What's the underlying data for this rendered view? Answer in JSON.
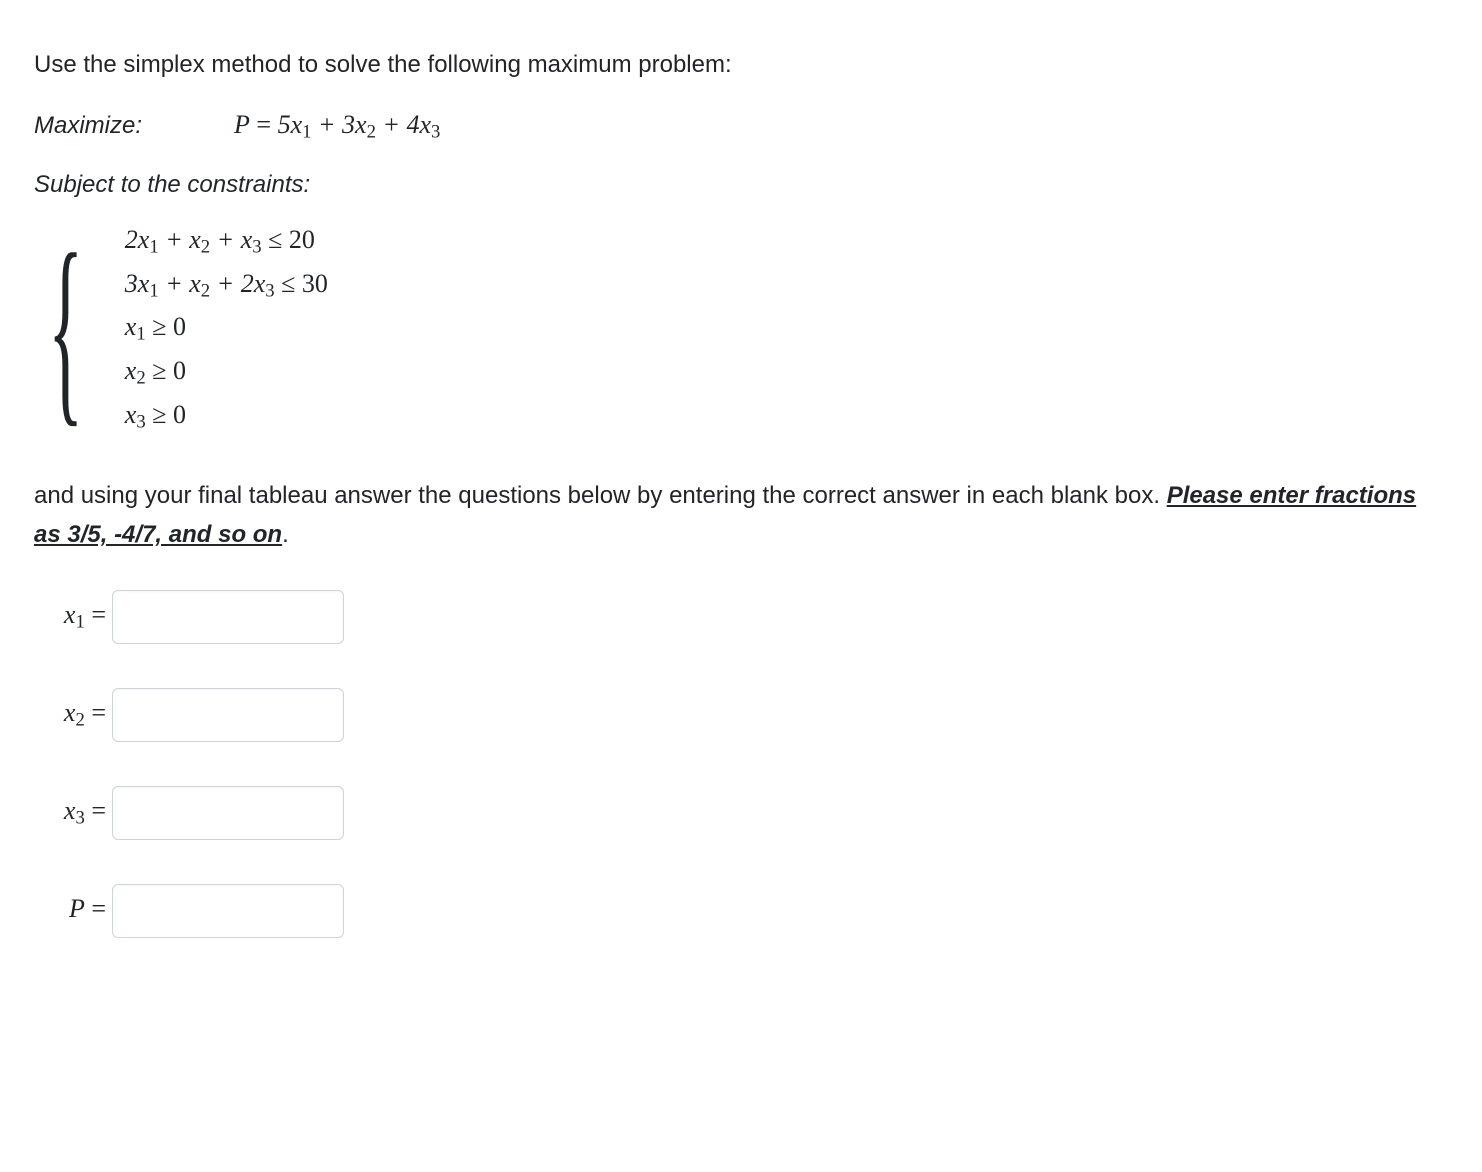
{
  "intro": "Use the simplex method to solve the following maximum problem:",
  "maximize_label": "Maximize:",
  "objective": {
    "lhs": "P",
    "eq": " = ",
    "terms": [
      "5x",
      "1",
      " + 3x",
      "2",
      " + 4x",
      "3"
    ]
  },
  "subject_to_label": "Subject to the constraints:",
  "constraints": [
    {
      "text_parts": [
        "2x",
        "1",
        " + x",
        "2",
        " + x",
        "3",
        " ≤ 20"
      ]
    },
    {
      "text_parts": [
        "3x",
        "1",
        " + x",
        "2",
        " + 2x",
        "3",
        " ≤ 30"
      ]
    },
    {
      "text_parts": [
        "x",
        "1",
        " ≥ 0"
      ]
    },
    {
      "text_parts": [
        "x",
        "2",
        " ≥ 0"
      ]
    },
    {
      "text_parts": [
        "x",
        "3",
        " ≥ 0"
      ]
    }
  ],
  "explain_part1": "and using your final tableau answer the questions below by entering the correct answer in each blank box. ",
  "explain_underlined": "Please enter fractions as  3/5,  -4/7, and so on",
  "explain_part2": ".",
  "answers": [
    {
      "label_main": "x",
      "label_sub": "1",
      "label_suffix": " ="
    },
    {
      "label_main": "x",
      "label_sub": "2",
      "label_suffix": " ="
    },
    {
      "label_main": "x",
      "label_sub": "3",
      "label_suffix": " ="
    },
    {
      "label_main": "P",
      "label_sub": "",
      "label_suffix": " ="
    }
  ]
}
